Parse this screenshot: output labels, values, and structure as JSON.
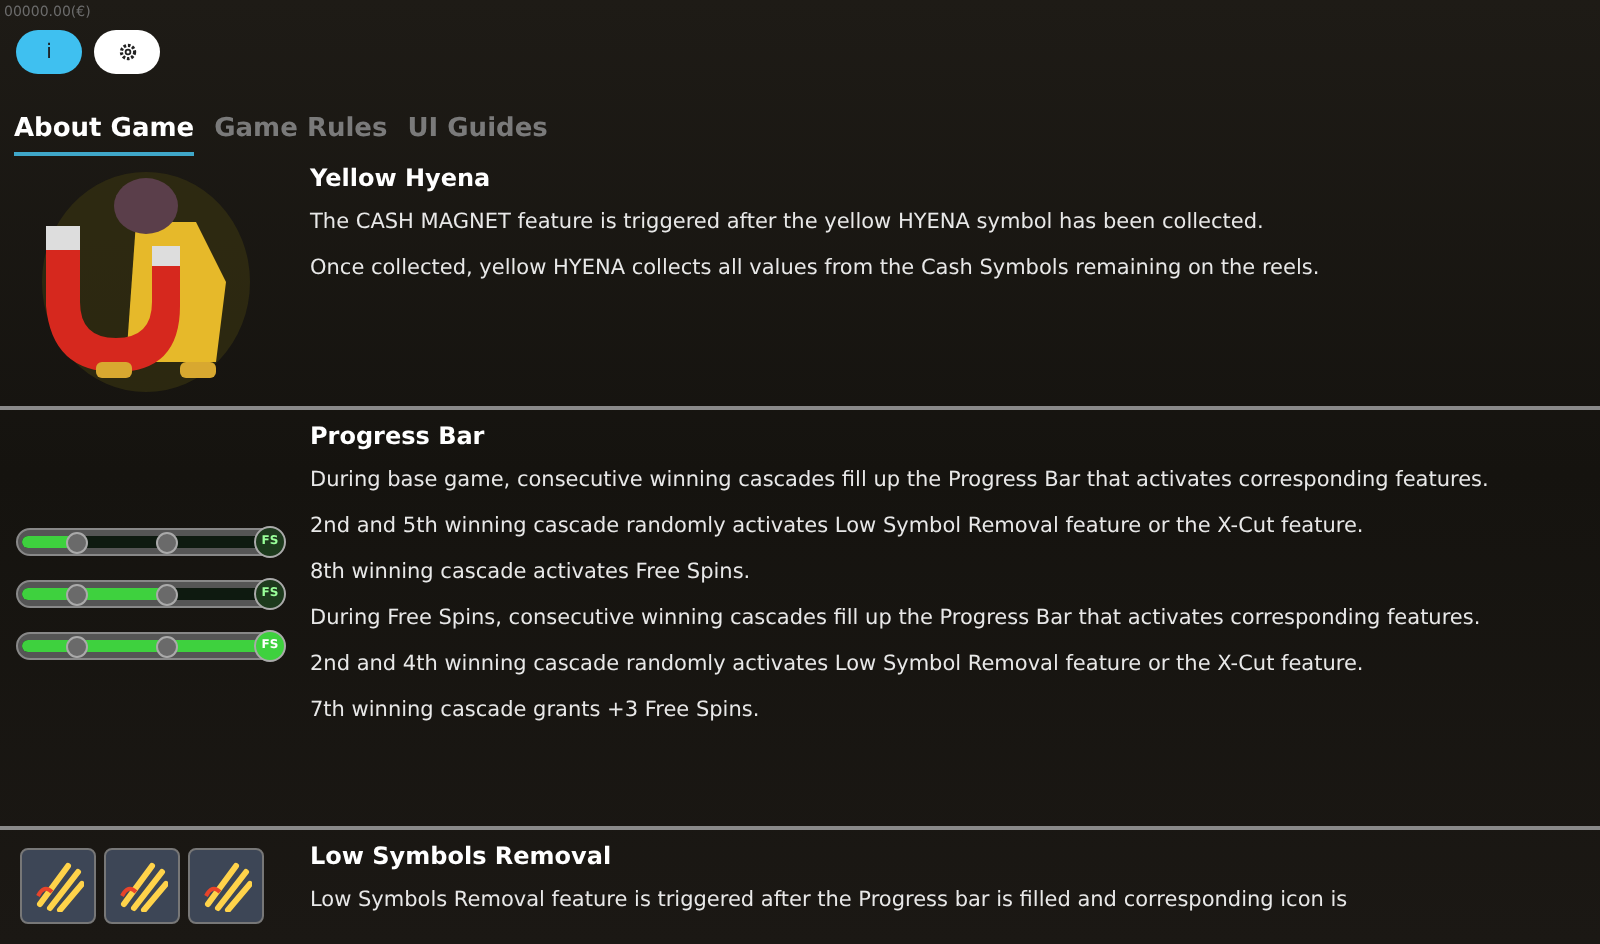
{
  "balance": "00000.00(€)",
  "top_buttons": [
    {
      "kind": "info",
      "label": "i",
      "selected": true
    },
    {
      "kind": "settings",
      "selected": false
    }
  ],
  "tabs": [
    {
      "label": "About Game",
      "selected": true
    },
    {
      "label": "Game Rules",
      "selected": false
    },
    {
      "label": "UI Guides",
      "selected": false
    }
  ],
  "sections": [
    {
      "kind": "hyena",
      "title": "Yellow Hyena",
      "paragraphs": [
        "The CASH MAGNET feature is triggered after the yellow HYENA symbol has been collected.",
        "Once collected, yellow HYENA collects all values from the Cash Symbols remaining on the reels."
      ]
    },
    {
      "kind": "progress",
      "title": "Progress Bar",
      "bars": [
        {
          "level": 0.25,
          "label": "FS"
        },
        {
          "level": 0.57,
          "label": "FS"
        },
        {
          "level": 1,
          "label": "FS"
        }
      ],
      "paragraphs": [
        "During base game, consecutive winning cascades fill up the Progress Bar that activates corresponding features.",
        "2nd and 5th winning cascade randomly activates Low Symbol Removal feature or the X-Cut feature.",
        "8th winning cascade activates Free Spins.",
        "During Free Spins, consecutive winning cascades fill up the Progress Bar that activates corresponding features.",
        "2nd and 4th winning cascade randomly activates Low Symbol Removal feature or the X-Cut feature.",
        "7th winning cascade grants +3 Free Spins."
      ]
    },
    {
      "kind": "removal",
      "title": "Low Symbols Removal",
      "paragraphs": [
        "Low Symbols Removal feature is triggered after the Progress bar is filled and corresponding icon is"
      ]
    }
  ]
}
